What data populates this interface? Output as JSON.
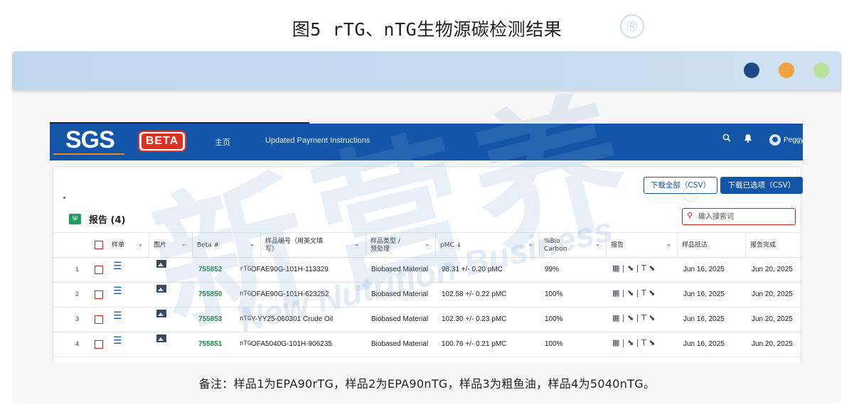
{
  "figure": {
    "title": "图5 rTG、nTG生物源碳检测结果",
    "reg_mark": "®",
    "note": "备注：样品1为EPA90rTG，样品2为EPA90nTG，样品3为粗鱼油，样品4为5040nTG。"
  },
  "window": {
    "dots": [
      {
        "name": "navy",
        "color": "#1d4a86"
      },
      {
        "name": "orange",
        "color": "#f0a23c"
      },
      {
        "name": "green",
        "color": "#b9e39a"
      }
    ]
  },
  "navbar": {
    "logo_sgs": "SGS",
    "logo_beta": "BETA",
    "home": "主页",
    "payment": "Updated Payment Instructions",
    "search_icon": "⚲",
    "bell_icon": "🔔",
    "user": "Peggy",
    "color": "#1356a8"
  },
  "toolbar": {
    "download_all": "下载全部（CSV）",
    "download_selected": "下载已选项（CSV）"
  },
  "reports": {
    "title": "报告 (4)",
    "search_placeholder": "输入搜索词"
  },
  "table": {
    "columns": [
      {
        "label": "样单",
        "chevron": true
      },
      {
        "label": "图片",
        "chevron": true
      },
      {
        "label": "Beta #",
        "chevron": true
      },
      {
        "label": "样品编号（用英文填\n写）",
        "chevron": true
      },
      {
        "label": "样品类型 /\n预处理",
        "chevron": true
      },
      {
        "label": "pMC ↓",
        "chevron": true
      },
      {
        "label": "%Bio\nCarbon",
        "chevron": true
      },
      {
        "label": "报告",
        "chevron": true
      },
      {
        "label": "样品抵达",
        "chevron": false
      },
      {
        "label": "报告完成",
        "chevron": false
      }
    ],
    "rows": [
      {
        "num": "1",
        "beta": "755852",
        "tag": "rTG",
        "sample": "OFAE90G-101H-113329",
        "material": "Biobased Material",
        "pmc": "98.31 +/- 0.20 pMC",
        "bio": "99%",
        "report": "▦ | ⬊ | T ⬊",
        "received": "Jun 16, 2025",
        "completed": "Jun 20, 2025"
      },
      {
        "num": "2",
        "beta": "755850",
        "tag": "nTG",
        "sample": "OFAE90G-101H-623252",
        "material": "Biobased Material",
        "pmc": "102.58 +/- 0.22 pMC",
        "bio": "100%",
        "report": "▦ | ⬊ | T ⬊",
        "received": "Jun 16, 2025",
        "completed": "Jun 20, 2025"
      },
      {
        "num": "3",
        "beta": "755853",
        "tag": "nTG",
        "sample": "Y-YY25-060301 Crude Oil",
        "material": "Biobased Material",
        "pmc": "102.30 +/- 0.23 pMC",
        "bio": "100%",
        "report": "▦ | ⬊ | T ⬊",
        "received": "Jun 16, 2025",
        "completed": "Jun 20, 2025"
      },
      {
        "num": "4",
        "beta": "755851",
        "tag": "nTG",
        "sample": "OFA5040G-101H-906235",
        "material": "Biobased Material",
        "pmc": "100.76 +/- 0.21 pMC",
        "bio": "100%",
        "report": "▦ | ⬊ | T ⬊",
        "received": "Jun 16, 2025",
        "completed": "Jun 20, 2025"
      }
    ]
  },
  "watermark": {
    "cn": "新营养",
    "en": "New Nutrition Business",
    "reg": "®"
  }
}
